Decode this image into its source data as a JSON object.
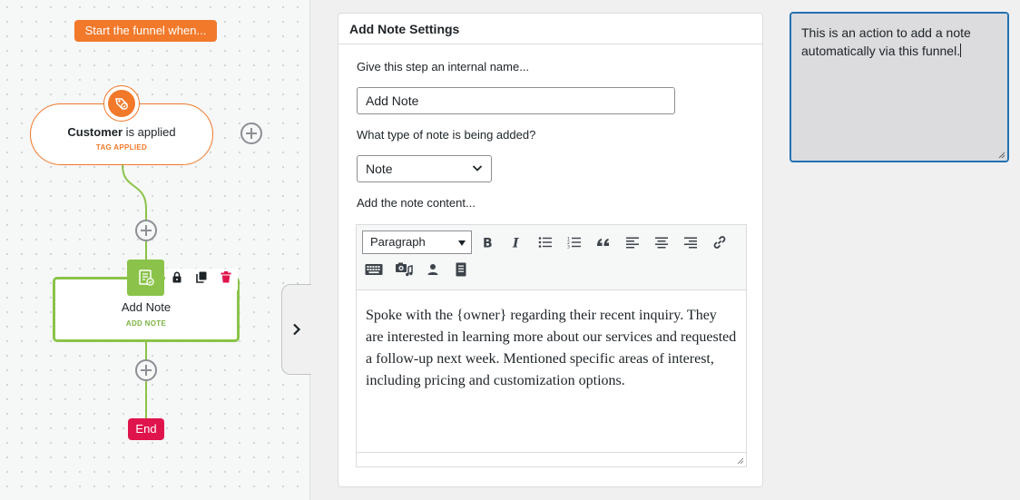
{
  "canvas": {
    "trigger_label": "Start the funnel when...",
    "trigger_node": {
      "title_bold": "Customer",
      "title_rest": " is applied",
      "subtitle": "TAG APPLIED"
    },
    "action_node": {
      "title": "Add Note",
      "subtitle": "ADD NOTE"
    },
    "end_label": "End",
    "colors": {
      "trigger": "#f2792a",
      "action": "#8bc34a",
      "end": "#e0144c",
      "connector": "#8bc34a"
    }
  },
  "settings": {
    "header": "Add Note Settings",
    "name_label": "Give this step an internal name...",
    "name_value": "Add Note",
    "type_label": "What type of note is being added?",
    "type_value": "Note",
    "content_label": "Add the note content...",
    "editor": {
      "format_value": "Paragraph",
      "toolbar_icons": [
        "bold-icon",
        "italic-icon",
        "bullet-list-icon",
        "numbered-list-icon",
        "blockquote-icon",
        "align-left-icon",
        "align-center-icon",
        "align-right-icon",
        "link-icon",
        "keyboard-icon",
        "media-icon",
        "person-icon",
        "document-icon"
      ],
      "content": "Spoke with the {owner} regarding their recent inquiry. They are interested in learning more about our services and requested a follow-up next week. Mentioned specific areas of interest, including pricing and customization options."
    }
  },
  "description": {
    "value": "This is an action to add a note automatically via this funnel."
  }
}
